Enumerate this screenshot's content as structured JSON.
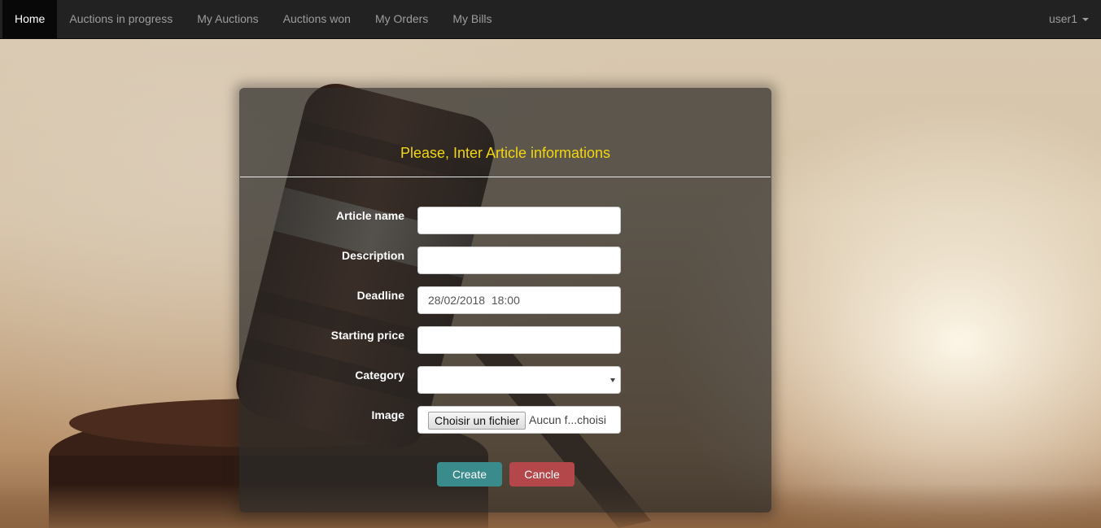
{
  "navbar": {
    "items": [
      {
        "label": "Home",
        "active": true
      },
      {
        "label": "Auctions in progress",
        "active": false
      },
      {
        "label": "My Auctions",
        "active": false
      },
      {
        "label": "Auctions won",
        "active": false
      },
      {
        "label": "My Orders",
        "active": false
      },
      {
        "label": "My Bills",
        "active": false
      }
    ],
    "user": "user1"
  },
  "form": {
    "title": "Please, Inter Article informations",
    "fields": {
      "article_name": {
        "label": "Article name",
        "value": ""
      },
      "description": {
        "label": "Description",
        "value": ""
      },
      "deadline": {
        "label": "Deadline",
        "value": "28/02/2018  18:00"
      },
      "starting_price": {
        "label": "Starting price",
        "value": ""
      },
      "category": {
        "label": "Category",
        "value": ""
      },
      "image": {
        "label": "Image",
        "button": "Choisir un fichier",
        "status": "Aucun f...choisi"
      }
    },
    "buttons": {
      "create": "Create",
      "cancel": "Cancle"
    }
  },
  "colors": {
    "navbar_bg": "#222222",
    "title": "#f2d60f",
    "create_button": "#3a8b8c",
    "cancel_button": "#b3474a"
  }
}
